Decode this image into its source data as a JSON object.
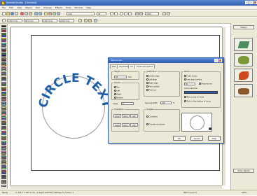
{
  "window": {
    "title": "Embird Studio - [Untitled]"
  },
  "menu": [
    "File",
    "Edit",
    "View",
    "Object",
    "Text",
    "Arrange",
    "Effects",
    "Tools",
    "Window",
    "Help"
  ],
  "toolbar1": {
    "font_name": "Arial",
    "font_size": "36",
    "zoom": "100%"
  },
  "toolbar2": {
    "x_field": "120.0 mm",
    "y_field": "85.0 mm",
    "w_field": "100.0 mm",
    "h_field": "100.0 mm"
  },
  "palette": {
    "colors": [
      "#000000",
      "#ffffff",
      "#ff0000",
      "#00a000",
      "#0000ff",
      "#ffff00",
      "#ff00ff",
      "#00ffff",
      "#808080",
      "#c0c0c0",
      "#800000",
      "#008000",
      "#000080",
      "#808000",
      "#800080",
      "#008080",
      "#ff8000",
      "#ff80c0",
      "#80ff80",
      "#8080ff",
      "#ffcc99",
      "#663300",
      "#99ccff",
      "#cc99ff",
      "#339933",
      "#ffcc00",
      "#cc0033",
      "#0066cc",
      "#66cc00",
      "#993366",
      "#ff6666",
      "#6666ff",
      "#33cccc",
      "#cccc33",
      "#996633",
      "#336699",
      "#ff9966",
      "#66ff99",
      "#9966ff",
      "#cc6600",
      "#006633",
      "#663399",
      "#ccff66",
      "#ff3399",
      "#3399ff",
      "#99ff33",
      "#ff6633",
      "#33ff99",
      "#6633ff",
      "#cc3366",
      "#66cccc",
      "#cc66cc",
      "#999933",
      "#339966",
      "#993399",
      "#669933",
      "#cc9933",
      "#3366cc",
      "#66cc66",
      "#cc3333",
      "#3333cc",
      "#333333",
      "#666666",
      "#999999",
      "#cccccc",
      "#eeeeee"
    ]
  },
  "canvas": {
    "curved_text": "CIRCLE TEXT",
    "text_color": "#1f5fa8"
  },
  "dialog": {
    "title": "Text on arc",
    "tabs": [
      "Text",
      "Alignment",
      "Arc",
      "Advanced options"
    ],
    "group_height_label": "Height",
    "height_value": "20",
    "height_unit": "mm",
    "group_position_label": "Position",
    "position_options": [
      {
        "label": "Top",
        "checked": true
      },
      {
        "label": "Left",
        "checked": false
      },
      {
        "label": "Right",
        "checked": false
      },
      {
        "label": "Bottom",
        "checked": false
      }
    ],
    "group_orientation_label": "Orientation",
    "orientation_buttons": [
      "Upper",
      "Right",
      "Left",
      "Lower",
      "Right",
      "Left"
    ],
    "angle_label": "Angle",
    "angle_value": "0",
    "group_justification_label": "Justification",
    "justification_options": [
      {
        "label": "Center align",
        "checked": true
      },
      {
        "label": "Left align",
        "checked": false
      },
      {
        "label": "Right align",
        "checked": false
      },
      {
        "label": "Force justify",
        "checked": false
      },
      {
        "label": "Fit to arc",
        "checked": false
      }
    ],
    "spacing_label": "Spacing width",
    "spacing_value": "100",
    "spacing_unit": "%",
    "group_radius_label": "Radius",
    "radius_options": [
      {
        "label": "Fixed radius",
        "checked": false
      },
      {
        "label": "Use object radius",
        "checked": true
      },
      {
        "label": "Proportional",
        "checked": false
      }
    ],
    "radius_value": "50",
    "curve_direction_label": "Curve direction",
    "curve_options": [
      {
        "label": "Text on top of circle",
        "checked": true
      },
      {
        "label": "Text on the bottom of circle",
        "checked": false
      }
    ],
    "group_analysis_label": "Analysis",
    "analysis_options": [
      {
        "label": "Clockwise",
        "checked": true
      },
      {
        "label": "Counter-clockwise",
        "checked": false
      }
    ],
    "ok_label": "OK",
    "cancel_label": "Cancel",
    "help_label": "Help"
  },
  "right_panel": {
    "header": "Design",
    "bottom_button": "Show objects"
  },
  "status": {
    "left": "Ready",
    "mid": "X: 115.7 Y: 183.1 mm | 1 object selected | Stitches: 0 | Colors: 1",
    "right": "Stitch count: 0",
    "zoom": "100%"
  }
}
